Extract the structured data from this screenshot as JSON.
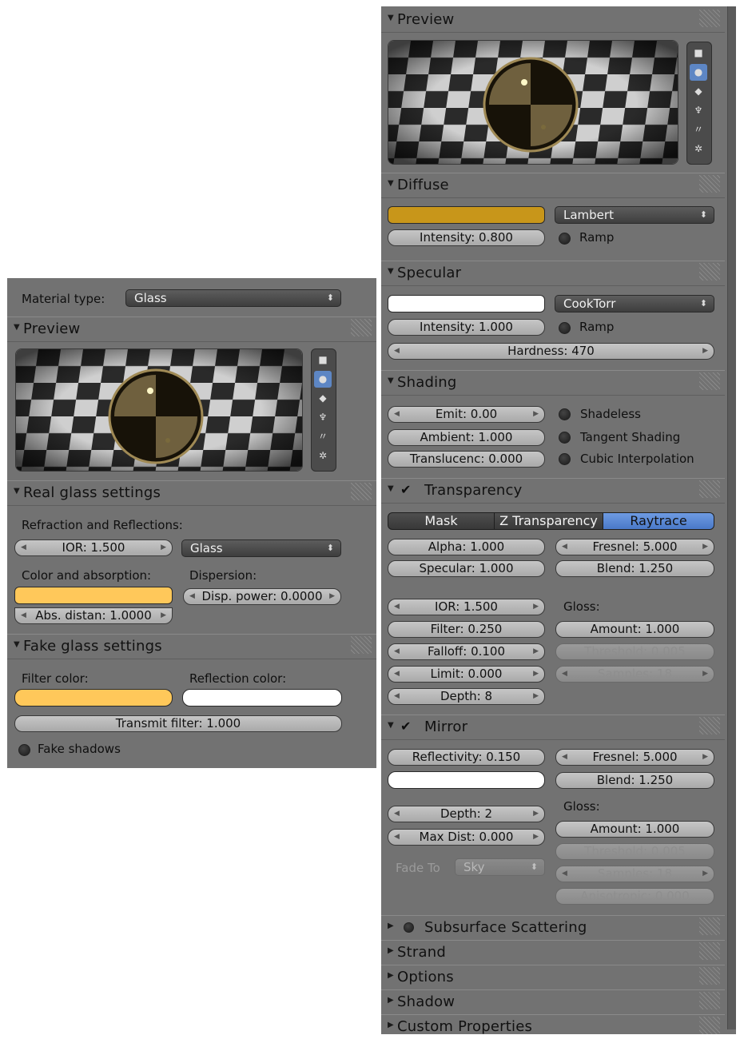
{
  "left": {
    "material_type_label": "Material type:",
    "material_type_value": "Glass",
    "preview_title": "Preview",
    "real_glass_title": "Real glass settings",
    "refraction_label": "Refraction and Reflections:",
    "ior": "IOR: 1.500",
    "ior_type": "Glass",
    "color_abs_label": "Color and absorption:",
    "dispersion_label": "Dispersion:",
    "disp_power": "Disp. power: 0.0000",
    "abs_distan": "Abs. distan: 1.0000",
    "fake_glass_title": "Fake glass settings",
    "filter_color_label": "Filter color:",
    "reflection_color_label": "Reflection color:",
    "transmit_filter": "Transmit filter: 1.000",
    "fake_shadows": "Fake shadows"
  },
  "right": {
    "preview_title": "Preview",
    "diffuse_title": "Diffuse",
    "diffuse_shader": "Lambert",
    "diffuse_intensity": "Intensity: 0.800",
    "diffuse_ramp": "Ramp",
    "specular_title": "Specular",
    "specular_shader": "CookTorr",
    "specular_intensity": "Intensity: 1.000",
    "specular_ramp": "Ramp",
    "hardness": "Hardness: 470",
    "shading_title": "Shading",
    "emit": "Emit: 0.00",
    "ambient": "Ambient: 1.000",
    "translucency": "Translucenc: 0.000",
    "shadeless": "Shadeless",
    "tangent_shading": "Tangent Shading",
    "cubic_interp": "Cubic Interpolation",
    "transparency_title": "Transparency",
    "mode_mask": "Mask",
    "mode_ztransp": "Z Transparency",
    "mode_raytrace": "Raytrace",
    "alpha": "Alpha: 1.000",
    "t_specular": "Specular: 1.000",
    "t_fresnel": "Fresnel: 5.000",
    "t_blend": "Blend: 1.250",
    "t_ior": "IOR: 1.500",
    "t_filter": "Filter: 0.250",
    "t_falloff": "Falloff: 0.100",
    "t_limit": "Limit: 0.000",
    "t_depth": "Depth: 8",
    "t_gloss": "Gloss:",
    "t_amount": "Amount: 1.000",
    "t_threshold": "Threshold: 0.005",
    "t_samples": "Samples: 18",
    "mirror_title": "Mirror",
    "reflectivity": "Reflectivity: 0.150",
    "m_fresnel": "Fresnel: 5.000",
    "m_blend": "Blend: 1.250",
    "m_depth": "Depth: 2",
    "m_maxdist": "Max Dist: 0.000",
    "fade_to_label": "Fade To",
    "fade_to_value": "Sky",
    "m_gloss": "Gloss:",
    "m_amount": "Amount: 1.000",
    "m_threshold": "Threshold: 0.005",
    "m_samples": "Samples: 18",
    "m_anisotropic": "Anisotropic: 0.000",
    "sss_title": "Subsurface Scattering",
    "strand_title": "Strand",
    "options_title": "Options",
    "shadow_title": "Shadow",
    "custom_props_title": "Custom Properties"
  },
  "colors": {
    "panel_bg": "#727272",
    "diffuse_color": "#c8961a",
    "glass_color": "#ffc85a",
    "white": "#ffffff",
    "accent_blue": "#5b89d6"
  }
}
